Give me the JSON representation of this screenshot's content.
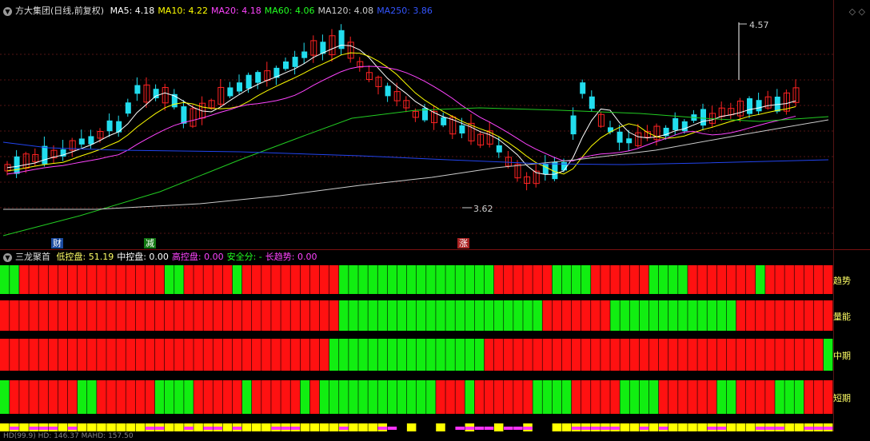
{
  "header": {
    "title": "方大集团(日线,前复权)",
    "ma": [
      {
        "label": "MA5:",
        "value": "4.18",
        "color": "#ffffff"
      },
      {
        "label": "MA10:",
        "value": "4.22",
        "color": "#ffff00"
      },
      {
        "label": "MA20:",
        "value": "4.18",
        "color": "#ff44ff"
      },
      {
        "label": "MA60:",
        "value": "4.06",
        "color": "#22ff22"
      },
      {
        "label": "MA120:",
        "value": "4.08",
        "color": "#cccccc"
      },
      {
        "label": "MA250:",
        "value": "3.86",
        "color": "#3355ff"
      }
    ]
  },
  "price": {
    "high_label": "4.57",
    "low_label": "3.62",
    "markers": [
      "财",
      "减",
      "涨"
    ],
    "colors": {
      "up": "#ff2222",
      "down": "#22ddee",
      "ma5": "#ffffff",
      "ma10": "#ffff00",
      "ma20": "#ff44ff",
      "ma60": "#22cc22",
      "ma120": "#cccccc",
      "ma250": "#2244ee"
    }
  },
  "indicator": {
    "name": "三龙聚首",
    "fields": [
      {
        "label": "低控盘:",
        "value": "51.19",
        "color": "#ffff66"
      },
      {
        "label": "中控盘:",
        "value": "0.00",
        "color": "#ffffff"
      },
      {
        "label": "高控盘:",
        "value": "0.00",
        "color": "#ff44ff"
      },
      {
        "label": "安全分:",
        "value": "-",
        "color": "#22ff22"
      },
      {
        "label": "长趋势:",
        "value": "0.00",
        "color": "#ff44ff"
      }
    ],
    "bands": [
      "趋势",
      "量能",
      "中期",
      "短期"
    ],
    "colors": {
      "red": "#ff1111",
      "green": "#11ee11",
      "yellow": "#ffff00",
      "magenta": "#ff33ff"
    }
  },
  "footer": {
    "text": "HD(99.9) HD: 146.37 MAHD: 157.50"
  }
}
